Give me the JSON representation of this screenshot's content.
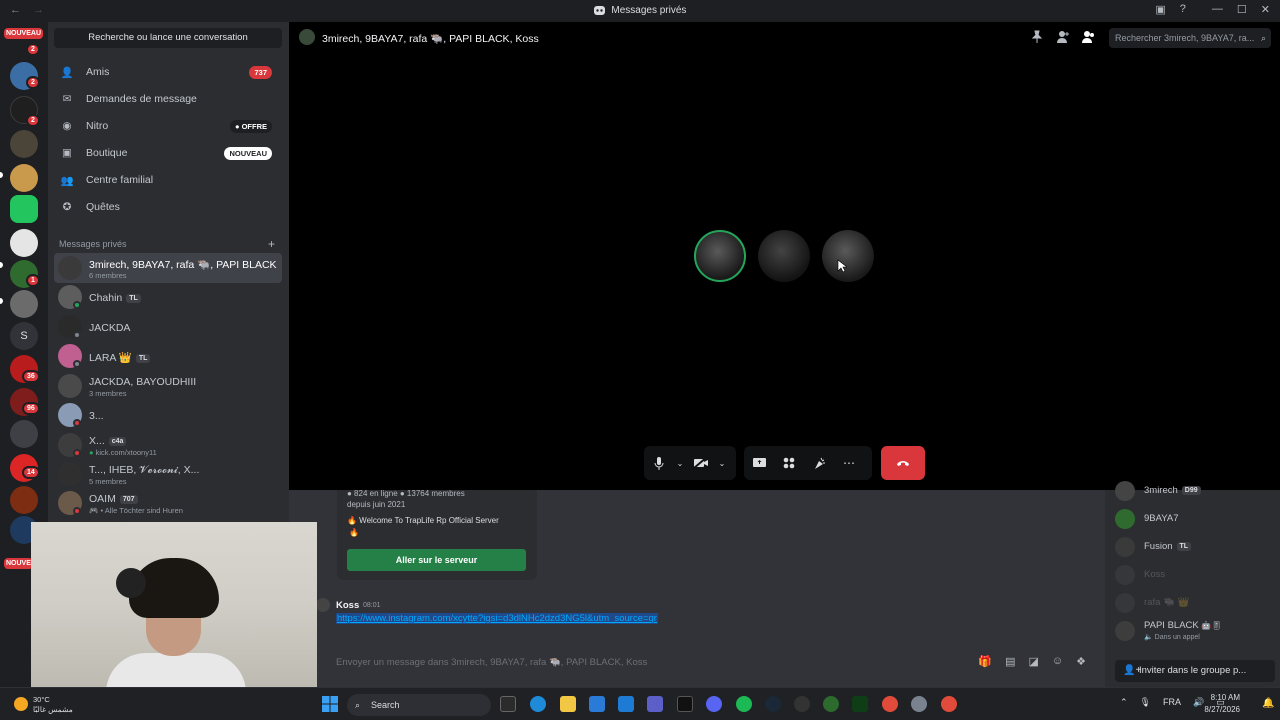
{
  "window": {
    "title": "Messages privés"
  },
  "rail": {
    "top_badge": "NOUVEAU",
    "bottom_badge": "NOUVE",
    "letter": "S",
    "counts": [
      "2",
      "2",
      "2",
      "1",
      "36",
      "96",
      "14"
    ]
  },
  "sidebar": {
    "search": "Recherche ou lance une conversation",
    "nav": [
      {
        "label": "Amis",
        "badge": "737"
      },
      {
        "label": "Demandes de message",
        "badge": ""
      },
      {
        "label": "Nitro",
        "badge": "OFFRE"
      },
      {
        "label": "Boutique",
        "badge": "NOUVEAU"
      },
      {
        "label": "Centre familial",
        "badge": ""
      },
      {
        "label": "Quêtes",
        "badge": ""
      }
    ],
    "dm_header": "Messages privés",
    "dms": [
      {
        "name": "3mirech, 9BAYA7, rafa 🐃, PAPI BLACK,...",
        "sub": "6 membres"
      },
      {
        "name": "Chahin",
        "tag": "TL",
        "sub": ""
      },
      {
        "name": "JACKDA",
        "sub": ""
      },
      {
        "name": "LARA 👑",
        "tag": "TL",
        "sub": ""
      },
      {
        "name": "JACKDA, BAYOUDHIII",
        "sub": "3 membres"
      },
      {
        "name": "3...",
        "sub": ""
      },
      {
        "name": "X...",
        "tag": "c4a",
        "sub": "kick.com/xtoony11"
      },
      {
        "name": "T..., IHEB, 𝓥𝓮𝓻𝓸𝓸𝓷𝓲, X...",
        "sub": "5 membres"
      },
      {
        "name": "OAIM",
        "tag": "707",
        "sub": "• Alle Töchter sind Huren"
      }
    ]
  },
  "header": {
    "title": "3mirech, 9BAYA7, rafa 🐃, PAPI BLACK, Koss",
    "search_placeholder": "Rechercher 3mirech, 9BAYA7, ra..."
  },
  "invite_card": {
    "stats": "● 824 en ligne  ● 13764 membres",
    "since": "depuis juin 2021",
    "desc": "🔥 Welcome To TrapLife Rp Official Server",
    "fire": "🔥",
    "join": "Aller sur le serveur"
  },
  "message": {
    "author": "Koss",
    "time": "08:01",
    "link": "https://www.instagram.com/xcytte?igsi=d3dlNHc2dzd3NG5l&utm_source=qr"
  },
  "composer": {
    "placeholder": "Envoyer un message dans 3mirech, 9BAYA7, rafa 🐃, PAPI BLACK, Koss"
  },
  "members": [
    {
      "name": "3mirech",
      "tag": "D99",
      "dim": false
    },
    {
      "name": "9BAYA7",
      "tag": "",
      "dim": false
    },
    {
      "name": "Fusion",
      "tag": "TL",
      "dim": false
    },
    {
      "name": "Koss",
      "tag": "",
      "dim": true
    },
    {
      "name": "rafa 🐃 👑",
      "tag": "",
      "dim": true
    },
    {
      "name": "PAPI BLACK",
      "tag": "",
      "sub": "Dans un appel",
      "dim": false
    }
  ],
  "invite_group": "Inviter dans le groupe p...",
  "taskbar": {
    "weather_temp": "30°C",
    "weather_desc": "مشمس غالبًا",
    "search": "Search",
    "lang": "FRA",
    "time": "8:10 AM",
    "date": "8/27/2026"
  },
  "colors": {
    "accent_red": "#da373c",
    "green": "#248046",
    "link": "#00a8fc"
  }
}
